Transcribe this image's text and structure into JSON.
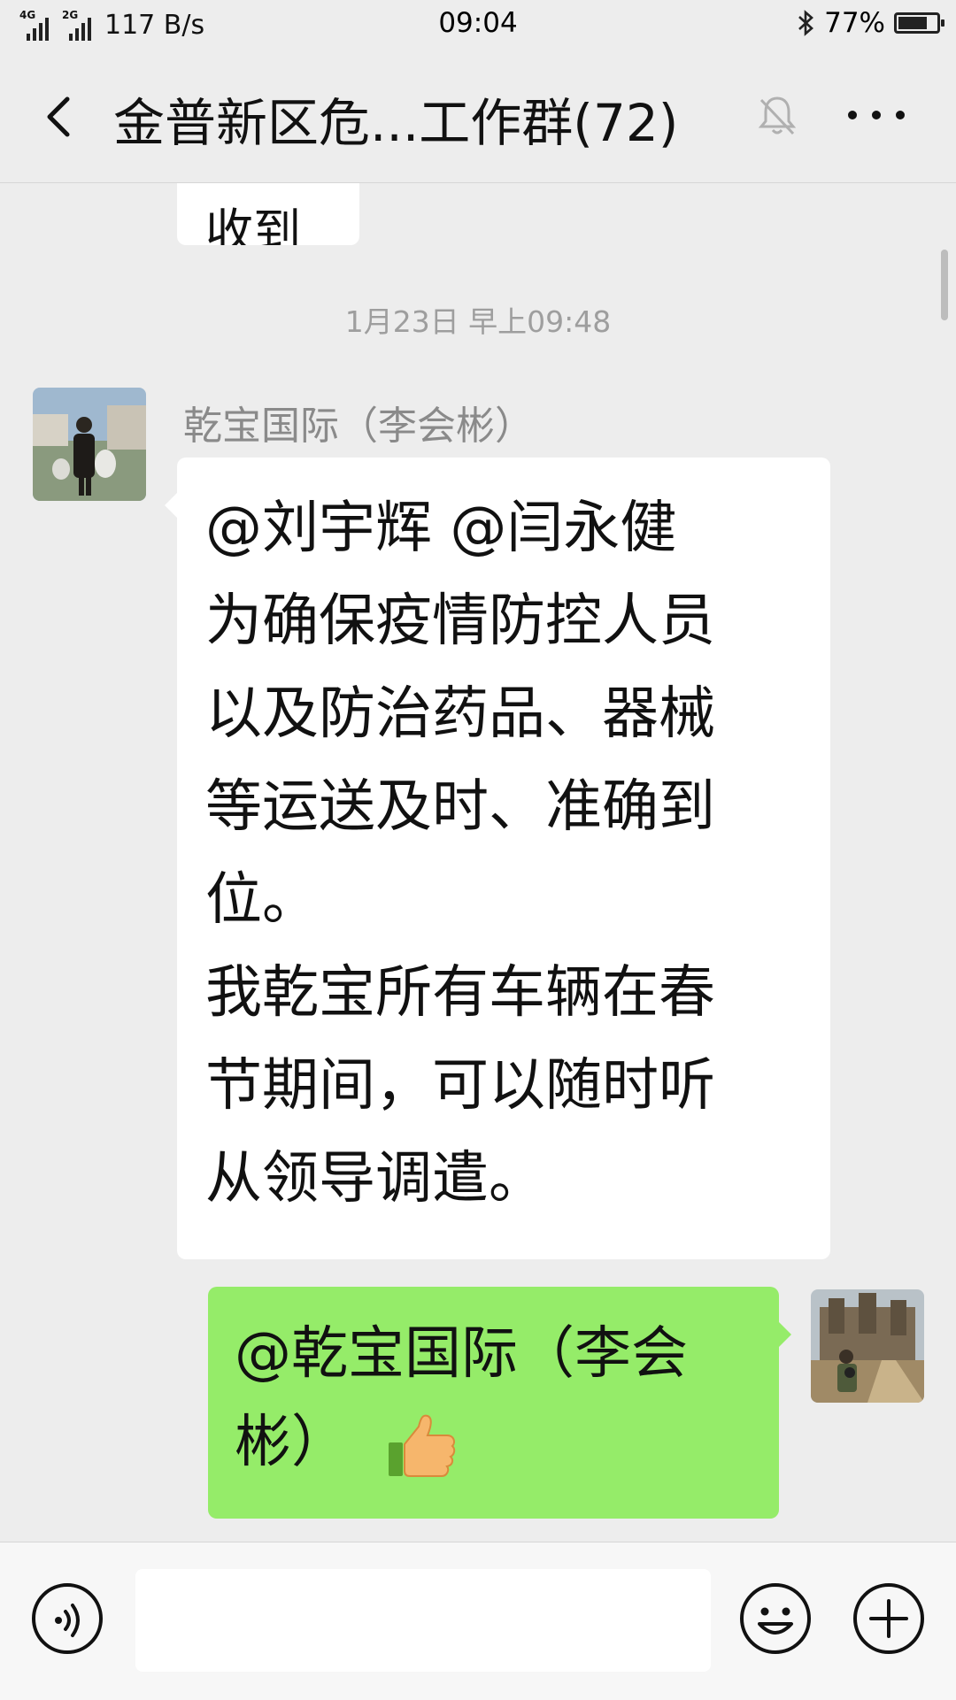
{
  "status_bar": {
    "signal_1_label": "4G",
    "signal_2_label": "2G",
    "net_speed": "117 B/s",
    "time": "09:04",
    "battery_text": "77%",
    "battery_level": 0.77
  },
  "header": {
    "title": "金普新区危...工作群(72)",
    "icons": [
      "back-arrow-icon",
      "mute-bell-icon",
      "more-icon"
    ]
  },
  "chat": {
    "previous_message_fragment": "收到",
    "timestamp": "1月23日 早上09:48",
    "messages": [
      {
        "direction": "incoming",
        "sender": "乾宝国际（李会彬）",
        "lines": [
          "@刘宇辉  @闫永健",
          "为确保疫情防控人员",
          "以及防治药品、器械",
          "等运送及时、准确到",
          "位。",
          "我乾宝所有车辆在春",
          "节期间，可以随时听",
          "从领导调遣。"
        ]
      },
      {
        "direction": "outgoing",
        "lines": [
          "@乾宝国际（李会",
          "彬）"
        ],
        "emoji": "thumbs-up-icon"
      }
    ]
  },
  "input_bar": {
    "placeholder": "",
    "icons": [
      "voice-icon",
      "emoji-icon",
      "plus-icon"
    ]
  },
  "colors": {
    "background": "#ededed",
    "incoming_bubble": "#ffffff",
    "outgoing_bubble": "#95ec69",
    "timestamp_text": "#9e9e9e",
    "sender_name": "#8a8a8a"
  }
}
